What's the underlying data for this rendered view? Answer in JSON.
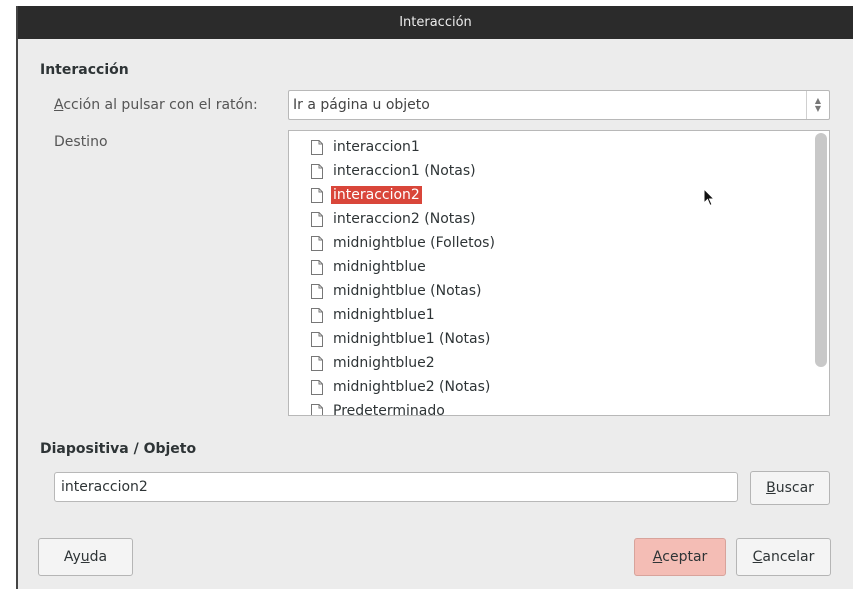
{
  "window": {
    "title": "Interacción"
  },
  "interaction_section": {
    "title": "Interacción",
    "action_label_prefix": "A",
    "action_label_rest": "cción al pulsar con el ratón:",
    "action_value": "Ir a página u objeto",
    "target_label": "Destino",
    "targets": [
      "interaccion1",
      "interaccion1 (Notas)",
      "interaccion2",
      "interaccion2 (Notas)",
      "midnightblue (Folletos)",
      "midnightblue",
      "midnightblue (Notas)",
      "midnightblue1",
      "midnightblue1 (Notas)",
      "midnightblue2",
      "midnightblue2 (Notas)",
      "Predeterminado"
    ],
    "selected_target": "interaccion2"
  },
  "slide_section": {
    "title": "Diapositiva / Objeto",
    "value": "interaccion2",
    "search_prefix": "B",
    "search_rest": "uscar"
  },
  "buttons": {
    "help_a": "Ay",
    "help_u": "u",
    "help_b": "da",
    "ok_prefix": "A",
    "ok_rest": "ceptar",
    "cancel_prefix": "C",
    "cancel_rest": "ancelar"
  },
  "colors": {
    "selection": "#d9463a",
    "primary_button": "#f4bdb5",
    "titlebar": "#2b2b2b"
  }
}
